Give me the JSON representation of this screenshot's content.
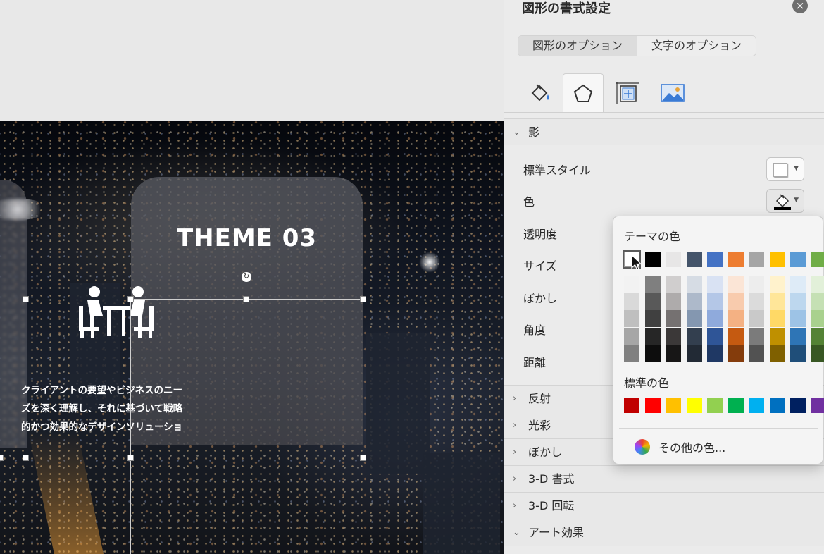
{
  "canvas": {
    "card_title": "THEME 03",
    "card_body_lines": [
      "クライアントの要望やビジネスのニー",
      "ズを深く理解し、それに基づいて戦略",
      "的かつ効果的なデザインソリューショ"
    ]
  },
  "panel": {
    "title": "図形の書式設定",
    "segments": [
      "図形のオプション",
      "文字のオプション"
    ],
    "icon_tabs": [
      "fill-line-icon",
      "shape-effects-icon",
      "size-properties-icon",
      "picture-icon"
    ],
    "sections": {
      "shadow": "影",
      "reflection": "反射",
      "glow": "光彩",
      "soft_edges": "ぼかし",
      "format_3d": "3-D 書式",
      "rotation_3d": "3-D 回転",
      "artistic": "アート効果"
    },
    "shadow_props": {
      "presets": "標準スタイル",
      "color": "色",
      "transparency": "透明度",
      "size": "サイズ",
      "blur": "ぼかし",
      "angle": "角度",
      "distance": "距離"
    }
  },
  "color_popup": {
    "theme_label": "テーマの色",
    "standard_label": "標準の色",
    "more_colors": "その他の色...",
    "theme_colors": [
      "#ffffff",
      "#000000",
      "#e7e6e6",
      "#44546a",
      "#4472c4",
      "#ed7d31",
      "#a5a5a5",
      "#ffc000",
      "#5b9bd5",
      "#70ad47"
    ],
    "theme_shades": [
      [
        "#f2f2f2",
        "#d9d9d9",
        "#bfbfbf",
        "#a6a6a6",
        "#808080"
      ],
      [
        "#7f7f7f",
        "#595959",
        "#404040",
        "#262626",
        "#0d0d0d"
      ],
      [
        "#d0cece",
        "#aeabab",
        "#757171",
        "#3b3838",
        "#171616"
      ],
      [
        "#d6dce4",
        "#adb9ca",
        "#8497b0",
        "#333f4f",
        "#222a35"
      ],
      [
        "#d9e2f3",
        "#b4c7e7",
        "#8faadc",
        "#2f5597",
        "#1f3864"
      ],
      [
        "#fbe5d6",
        "#f8cbad",
        "#f4b183",
        "#c55a11",
        "#843c0c"
      ],
      [
        "#ededed",
        "#dbdbdb",
        "#c9c9c9",
        "#7b7b7b",
        "#525252"
      ],
      [
        "#fff2cc",
        "#ffe699",
        "#ffd966",
        "#bf9000",
        "#7f6000"
      ],
      [
        "#deebf7",
        "#bdd7ee",
        "#9dc3e6",
        "#2e75b6",
        "#1f4e79"
      ],
      [
        "#e2f0d9",
        "#c5e0b4",
        "#a9d18e",
        "#548235",
        "#385723"
      ]
    ],
    "standard_colors": [
      "#c00000",
      "#ff0000",
      "#ffc000",
      "#ffff00",
      "#92d050",
      "#00b050",
      "#00b0f0",
      "#0070c0",
      "#002060",
      "#7030a0"
    ]
  }
}
